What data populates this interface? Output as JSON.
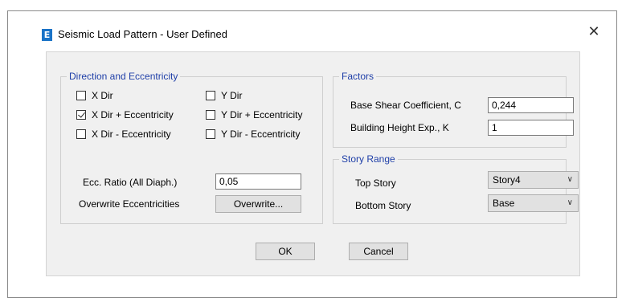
{
  "dialog": {
    "title": "Seismic Load Pattern - User Defined",
    "icon_letter": "E",
    "close_glyph": "✕"
  },
  "direction": {
    "group_title": "Direction and Eccentricity",
    "checkboxes": [
      {
        "label": "X Dir",
        "checked": false
      },
      {
        "label": "X Dir + Eccentricity",
        "checked": true
      },
      {
        "label": "X Dir - Eccentricity",
        "checked": false
      },
      {
        "label": "Y Dir",
        "checked": false
      },
      {
        "label": "Y Dir + Eccentricity",
        "checked": false
      },
      {
        "label": "Y Dir - Eccentricity",
        "checked": false
      }
    ],
    "ecc_ratio_label": "Ecc. Ratio (All Diaph.)",
    "ecc_ratio_value": "0,05",
    "overwrite_label": "Overwrite Eccentricities",
    "overwrite_button": "Overwrite..."
  },
  "factors": {
    "group_title": "Factors",
    "base_shear_label": "Base Shear Coefficient, C",
    "base_shear_value": "0,244",
    "height_exp_label": "Building Height Exp., K",
    "height_exp_value": "1"
  },
  "story_range": {
    "group_title": "Story Range",
    "top_label": "Top Story",
    "top_value": "Story4",
    "bottom_label": "Bottom Story",
    "bottom_value": "Base"
  },
  "buttons": {
    "ok": "OK",
    "cancel": "Cancel"
  },
  "colors": {
    "group_title": "#1f3fa8",
    "app_icon": "#1a73c7",
    "dialog_bg": "#f0f0f0"
  }
}
